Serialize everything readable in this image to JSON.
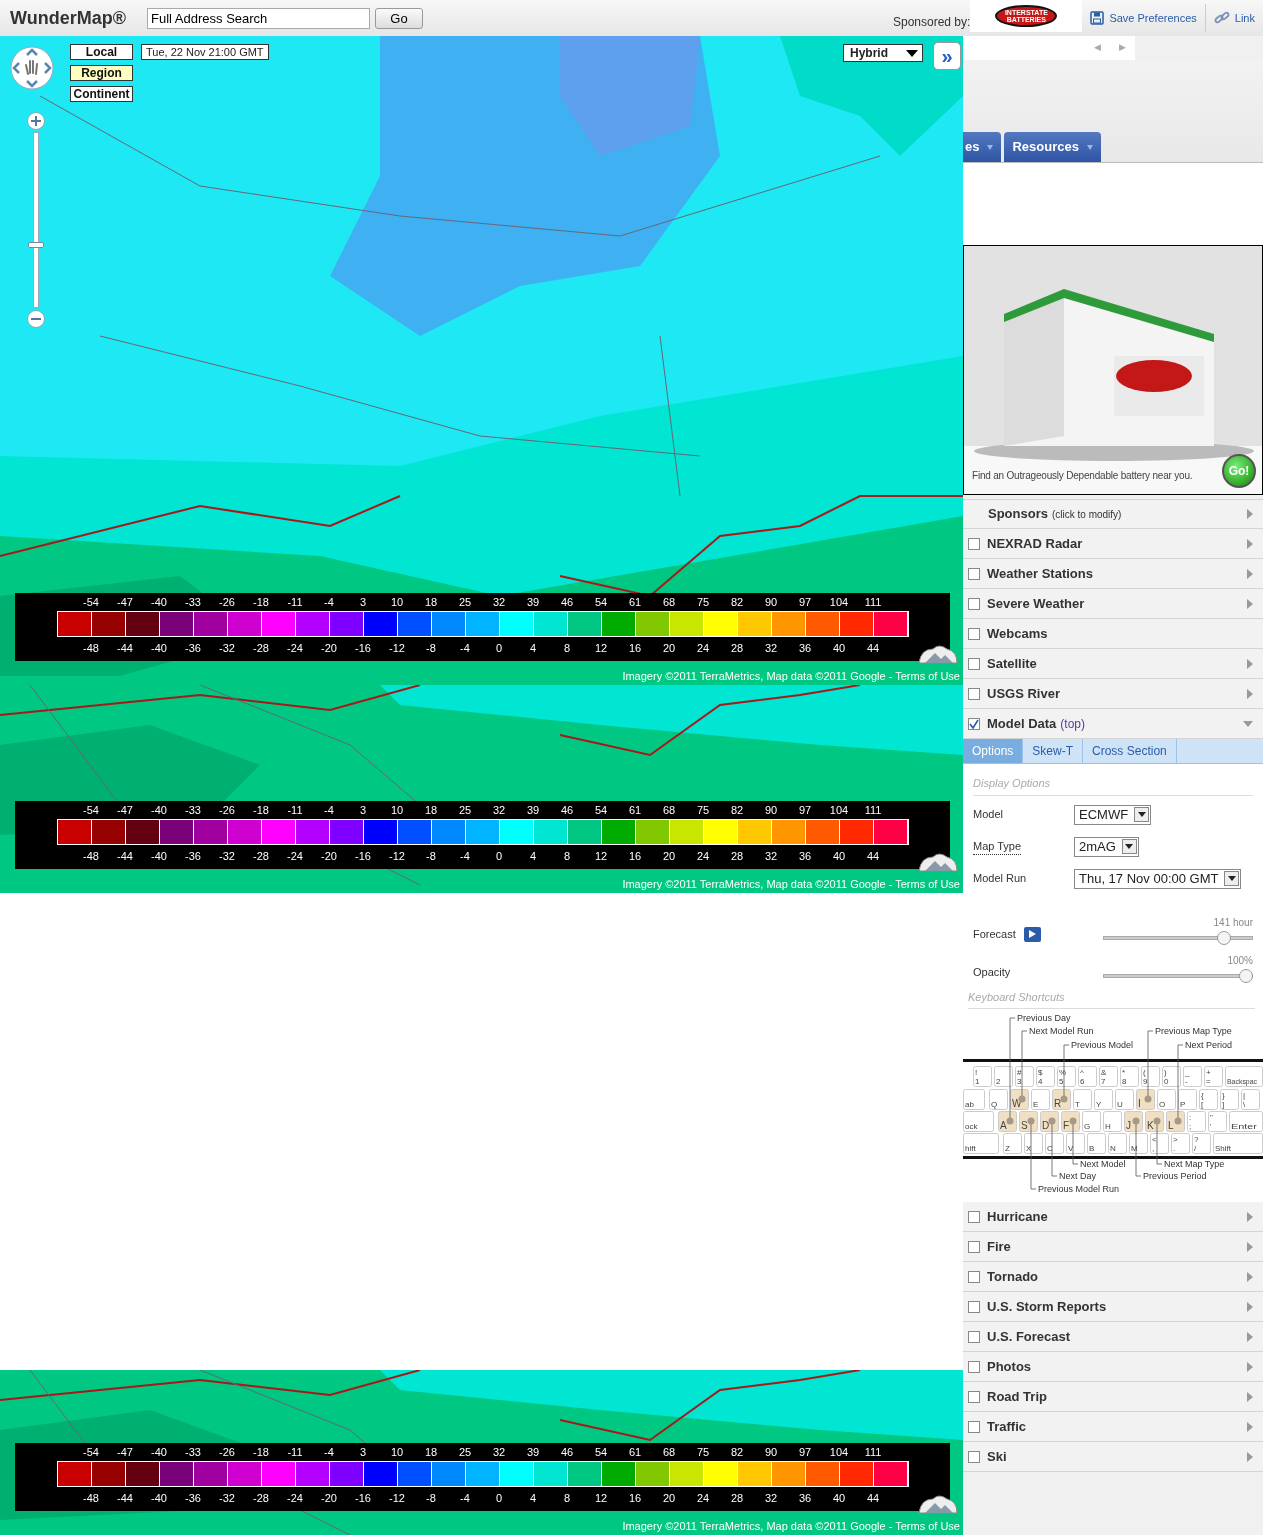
{
  "header": {
    "title": "WunderMap®",
    "search": {
      "value": "Full Address Search"
    },
    "go_button": "Go",
    "sponsored_label": "Sponsored by:",
    "sponsor_logo": "INTERSTATE BATTERIES",
    "save_preferences": "Save Preferences",
    "link": "Link"
  },
  "sponsor_pager": [
    "◀",
    "▶"
  ],
  "nav_tabs": [
    "es",
    "Resources"
  ],
  "map_controls": {
    "zoom": {
      "level": 0.35
    },
    "scopes": [
      {
        "label": "Local",
        "selected": false
      },
      {
        "label": "Region",
        "selected": true
      },
      {
        "label": "Continent",
        "selected": false
      }
    ],
    "time": "Tue, 22 Nov 21:00 GMT",
    "map_style": "Hybrid",
    "expand": "»"
  },
  "legend_cells": [
    {
      "color": "#c80000"
    },
    {
      "color": "#960000"
    },
    {
      "color": "#640010"
    },
    {
      "color": "#780078"
    },
    {
      "color": "#a000a0"
    },
    {
      "color": "#d000d0"
    },
    {
      "color": "#ff00ff"
    },
    {
      "color": "#b400ff"
    },
    {
      "color": "#8000ff"
    },
    {
      "color": "#0000ff"
    },
    {
      "color": "#0050ff"
    },
    {
      "color": "#0088ff"
    },
    {
      "color": "#00b4ff"
    },
    {
      "color": "#00ffff"
    },
    {
      "color": "#00e6d2"
    },
    {
      "color": "#00c882"
    },
    {
      "color": "#00aa00"
    },
    {
      "color": "#82c800"
    },
    {
      "color": "#c8e600"
    },
    {
      "color": "#ffff00"
    },
    {
      "color": "#ffc800"
    },
    {
      "color": "#ff9600"
    },
    {
      "color": "#ff5a00"
    },
    {
      "color": "#ff2800"
    },
    {
      "color": "#ff0046"
    }
  ],
  "map_panels": [
    {
      "kind": "full",
      "legend": {
        "f_labels": [
          "-54",
          "-47",
          "-40",
          "-33",
          "-26",
          "-18",
          "-11",
          "-4",
          "3",
          "10",
          "18",
          "25",
          "32",
          "39",
          "46",
          "54",
          "61",
          "68",
          "75",
          "82",
          "90",
          "97",
          "104",
          "111"
        ],
        "c_labels": [
          "-48",
          "-44",
          "-40",
          "-36",
          "-32",
          "-28",
          "-24",
          "-20",
          "-16",
          "-12",
          "-8",
          "-4",
          "0",
          "4",
          "8",
          "12",
          "16",
          "20",
          "24",
          "28",
          "32",
          "36",
          "40",
          "44"
        ]
      },
      "attribution": "Imagery ©2011 TerraMetrics, Map data ©2011 Google - Terms of Use"
    },
    {
      "kind": "strip",
      "legend": {
        "f_labels": [
          "-54",
          "-47",
          "-40",
          "-33",
          "-26",
          "-18",
          "-11",
          "-4",
          "3",
          "10",
          "18",
          "25",
          "32",
          "39",
          "46",
          "54",
          "61",
          "68",
          "75",
          "82",
          "90",
          "97",
          "104",
          "111"
        ],
        "c_labels": [
          "-48",
          "-44",
          "-40",
          "-36",
          "-32",
          "-28",
          "-24",
          "-20",
          "-16",
          "-12",
          "-8",
          "-4",
          "0",
          "4",
          "8",
          "12",
          "16",
          "20",
          "24",
          "28",
          "32",
          "36",
          "40",
          "44"
        ]
      },
      "attribution": "Imagery ©2011 TerraMetrics, Map data ©2011 Google - Terms of Use"
    },
    {
      "kind": "short",
      "legend": {
        "f_labels": [
          "-54",
          "-47",
          "-40",
          "-33",
          "-26",
          "-18",
          "-11",
          "-4",
          "3",
          "10",
          "18",
          "25",
          "32",
          "39",
          "46",
          "54",
          "61",
          "68",
          "75",
          "82",
          "90",
          "97",
          "104",
          "111"
        ],
        "c_labels": [
          "-48",
          "-44",
          "-40",
          "-36",
          "-32",
          "-28",
          "-24",
          "-20",
          "-16",
          "-12",
          "-8",
          "-4",
          "0",
          "4",
          "8",
          "12",
          "16",
          "20",
          "24",
          "28",
          "32",
          "36",
          "40",
          "44"
        ]
      },
      "attribution": "Imagery ©2011 TerraMetrics, Map data ©2011 Google - Terms of Use"
    }
  ],
  "ad": {
    "caption": "Find an Outrageously Dependable battery near you.",
    "button": "Go!"
  },
  "layers": [
    {
      "kind": "sponsor",
      "label": "Sponsors",
      "note": "(click to modify)",
      "submenu": true,
      "expanded": false
    },
    {
      "kind": "layer",
      "label": "NEXRAD Radar",
      "checked": false,
      "submenu": true,
      "expanded": false
    },
    {
      "kind": "layer",
      "label": "Weather Stations",
      "checked": false,
      "submenu": true,
      "expanded": false
    },
    {
      "kind": "layer",
      "label": "Severe Weather",
      "checked": false,
      "submenu": true,
      "expanded": false
    },
    {
      "kind": "layer",
      "label": "Webcams",
      "checked": false,
      "submenu": false
    },
    {
      "kind": "layer",
      "label": "Satellite",
      "checked": false,
      "submenu": true,
      "expanded": false
    },
    {
      "kind": "layer",
      "label": "USGS River",
      "checked": false,
      "submenu": true,
      "expanded": false
    },
    {
      "kind": "layer",
      "label": "Model Data",
      "tag": "(top)",
      "checked": true,
      "submenu": true,
      "expanded": true,
      "panel": {
        "tabs": [
          {
            "label": "Options",
            "selected": true
          },
          {
            "label": "Skew-T",
            "selected": false
          },
          {
            "label": "Cross Section",
            "selected": false
          }
        ],
        "display_heading": "Display Options",
        "fields": [
          {
            "label": "Model",
            "value": "ECMWF",
            "help": false
          },
          {
            "label": "Map Type",
            "value": "2mAG",
            "help": true
          },
          {
            "label": "Model Run",
            "value": "Thu, 17 Nov 00:00 GMT",
            "help": false
          }
        ],
        "sliders": [
          {
            "label": "Forecast",
            "reading": "141 hour",
            "level": 0.84,
            "play": true
          },
          {
            "label": "Opacity",
            "reading": "100%",
            "level": 1,
            "play": false
          }
        ],
        "shortcuts_heading": "Keyboard Shortcuts",
        "callouts_above": [
          "Previous Day",
          "Next Model Run",
          "Previous Map Type",
          "Previous Model",
          "Next Period"
        ],
        "keyboard": [
          [
            {
              "label": "1",
              "upper": "!"
            },
            {
              "label": "2"
            },
            {
              "label": "3",
              "upper": "#"
            },
            {
              "label": "4",
              "upper": "$"
            },
            {
              "label": "5",
              "upper": "%"
            },
            {
              "label": "6",
              "upper": "^"
            },
            {
              "label": "7",
              "upper": "&"
            },
            {
              "label": "8",
              "upper": "*"
            },
            {
              "label": "9",
              "upper": "("
            },
            {
              "label": "0",
              "upper": ")"
            },
            {
              "label": "-",
              "upper": "_"
            },
            {
              "label": "=",
              "upper": "+"
            },
            {
              "label": "Backspac",
              "kind": "wide"
            }
          ],
          [
            {
              "label": "ab",
              "kind": "wide"
            },
            {
              "label": "Q"
            },
            {
              "label": "W",
              "highlighted": true
            },
            {
              "label": "E"
            },
            {
              "label": "R",
              "highlighted": true
            },
            {
              "label": "T"
            },
            {
              "label": "Y"
            },
            {
              "label": "U"
            },
            {
              "label": "I",
              "highlighted": true
            },
            {
              "label": "O"
            },
            {
              "label": "P"
            },
            {
              "label": "[",
              "upper": "{"
            },
            {
              "label": "]",
              "upper": "}"
            },
            {
              "label": "\\",
              "upper": "|"
            }
          ],
          [
            {
              "label": "ock",
              "kind": "wide"
            },
            {
              "label": "A",
              "highlighted": true
            },
            {
              "label": "S",
              "highlighted": true
            },
            {
              "label": "D",
              "highlighted": true
            },
            {
              "label": "F",
              "highlighted": true
            },
            {
              "label": "G"
            },
            {
              "label": "H"
            },
            {
              "label": "J",
              "highlighted": true
            },
            {
              "label": "K",
              "highlighted": true
            },
            {
              "label": "L",
              "highlighted": true
            },
            {
              "label": ";",
              "upper": ":"
            },
            {
              "label": "'",
              "upper": "\""
            },
            {
              "label": "Enter",
              "kind": "wide"
            }
          ],
          [
            {
              "label": "hift",
              "kind": "wide"
            },
            {
              "label": "Z"
            },
            {
              "label": "X"
            },
            {
              "label": "C"
            },
            {
              "label": "V"
            },
            {
              "label": "B"
            },
            {
              "label": "N"
            },
            {
              "label": "M"
            },
            {
              "label": ",",
              "upper": "<"
            },
            {
              "label": ".",
              "upper": ">"
            },
            {
              "label": "/",
              "upper": "?"
            },
            {
              "label": "Shift",
              "kind": "wide"
            }
          ]
        ],
        "callouts_below": [
          "Next Model",
          "Next Map Type",
          "Next Day",
          "Previous Period",
          "Previous Model Run"
        ]
      }
    },
    {
      "kind": "layer",
      "label": "Hurricane",
      "checked": false,
      "submenu": true,
      "expanded": false
    },
    {
      "kind": "layer",
      "label": "Fire",
      "checked": false,
      "submenu": true,
      "expanded": false
    },
    {
      "kind": "layer",
      "label": "Tornado",
      "checked": false,
      "submenu": true,
      "expanded": false
    },
    {
      "kind": "layer",
      "label": "U.S. Storm Reports",
      "checked": false,
      "submenu": true,
      "expanded": false
    },
    {
      "kind": "layer",
      "label": "U.S. Forecast",
      "checked": false,
      "submenu": true,
      "expanded": false
    },
    {
      "kind": "layer",
      "label": "Photos",
      "checked": false,
      "submenu": true,
      "expanded": false
    },
    {
      "kind": "layer",
      "label": "Road Trip",
      "checked": false,
      "submenu": true,
      "expanded": false
    },
    {
      "kind": "layer",
      "label": "Traffic",
      "checked": false,
      "submenu": true,
      "expanded": false
    },
    {
      "kind": "layer",
      "label": "Ski",
      "checked": false,
      "submenu": true,
      "expanded": false
    }
  ]
}
